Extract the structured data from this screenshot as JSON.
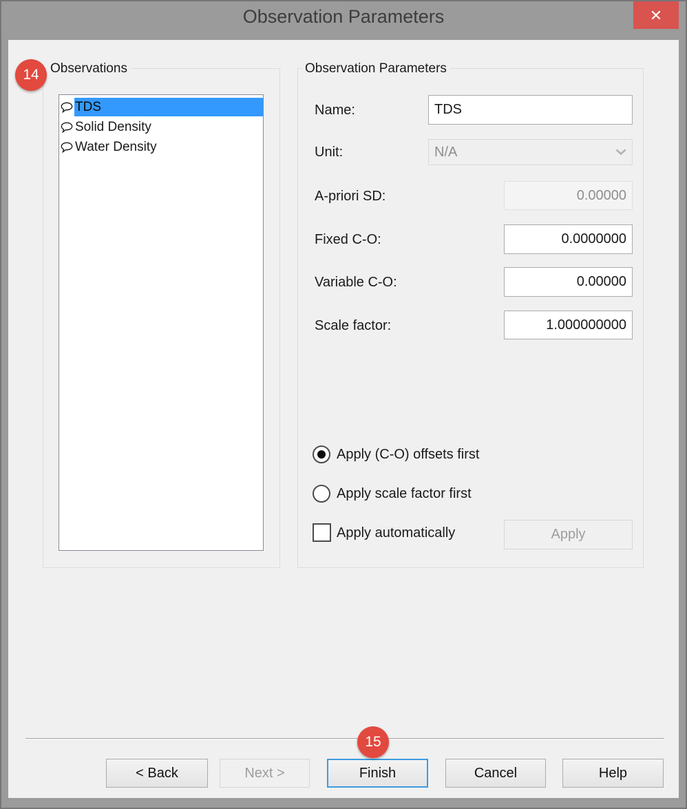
{
  "colors": {
    "accent_blue": "#3399ff",
    "close_red": "#d9534f",
    "badge_red": "#e2493f",
    "frame_gray": "#9b9b9b"
  },
  "window": {
    "title": "Observation Parameters",
    "close_glyph": "✕"
  },
  "badges": {
    "b14": "14",
    "b15": "15"
  },
  "observations": {
    "group_title": "Observations",
    "items": [
      {
        "label": "TDS",
        "selected": true
      },
      {
        "label": "Solid Density",
        "selected": false
      },
      {
        "label": "Water Density",
        "selected": false
      }
    ]
  },
  "params": {
    "group_title": "Observation Parameters",
    "name": {
      "label": "Name:",
      "value": "TDS",
      "disabled": false
    },
    "unit": {
      "label": "Unit:",
      "value": "N/A",
      "disabled": true
    },
    "apriori": {
      "label": "A-priori SD:",
      "value": "0.00000",
      "disabled": true
    },
    "fixed": {
      "label": "Fixed C-O:",
      "value": "0.0000000",
      "disabled": false
    },
    "variable": {
      "label": "Variable C-O:",
      "value": "0.00000",
      "disabled": false
    },
    "scale": {
      "label": "Scale factor:",
      "value": "1.000000000",
      "disabled": false
    },
    "radio_offsets": {
      "label": "Apply (C-O) offsets first",
      "selected": true
    },
    "radio_scale": {
      "label": "Apply scale factor first",
      "selected": false
    },
    "auto_checkbox": {
      "label": "Apply automatically",
      "checked": false
    },
    "apply_button": {
      "label": "Apply",
      "disabled": true
    }
  },
  "footer": {
    "back": "< Back",
    "next": "Next >",
    "finish": "Finish",
    "cancel": "Cancel",
    "help": "Help"
  }
}
